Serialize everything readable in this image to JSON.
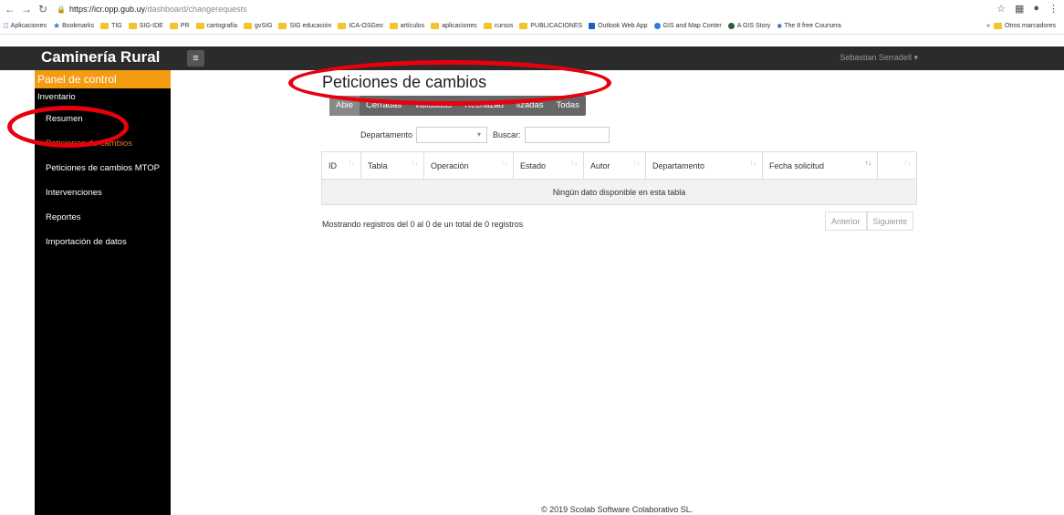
{
  "browser": {
    "url_host": "https://icr.opp.gub.uy",
    "url_path": "/dashboard/changerequests",
    "bookmarks": [
      {
        "label": "Aplicaciones",
        "icon": "apps-grid-icon"
      },
      {
        "label": "Bookmarks",
        "icon": "star-icon"
      },
      {
        "label": "TIG",
        "icon": "folder-icon"
      },
      {
        "label": "SIG-IDE",
        "icon": "folder-icon"
      },
      {
        "label": "PR",
        "icon": "folder-icon"
      },
      {
        "label": "cartografía",
        "icon": "folder-icon"
      },
      {
        "label": "gvSIG",
        "icon": "folder-icon"
      },
      {
        "label": "SIG educación",
        "icon": "folder-icon"
      },
      {
        "label": "ICA-OSGeo",
        "icon": "folder-icon"
      },
      {
        "label": "artículos",
        "icon": "folder-icon"
      },
      {
        "label": "aplicaciones",
        "icon": "folder-icon"
      },
      {
        "label": "cursos",
        "icon": "folder-icon"
      },
      {
        "label": "PUBLICACIONES",
        "icon": "folder-icon"
      },
      {
        "label": "Outlook Web App",
        "icon": "outlook-icon"
      },
      {
        "label": "GIS and Map Conter",
        "icon": "globe-icon"
      },
      {
        "label": "A GIS Story",
        "icon": "globe-icon"
      },
      {
        "label": "The 8 free Coursera",
        "icon": "coursera-icon"
      }
    ],
    "more": "»",
    "other_bookmarks": "Otros marcadores"
  },
  "app": {
    "brand": "Caminería Rural",
    "menu_toggle": "≡",
    "user": "Sebastian Serradell",
    "footer": "© 2019 Scolab Software Colaborativo SL."
  },
  "sidebar": {
    "header": "Panel de control",
    "items": [
      {
        "label": "Inventario"
      },
      {
        "label": "Resumen"
      },
      {
        "label": "Peticiones de cambios"
      },
      {
        "label": "Peticiones de cambios MTOP"
      },
      {
        "label": "Intervenciones"
      },
      {
        "label": "Reportes"
      },
      {
        "label": "Importación de datos"
      }
    ]
  },
  "main": {
    "title": "Peticiones de cambios",
    "tabs": [
      "Abie",
      "Cerradas",
      "Validadas",
      "Rechazad",
      "lizadas",
      "Todas"
    ],
    "filter_label": "Departamento",
    "search_label": "Buscar:",
    "columns": [
      "ID",
      "Tabla",
      "Operación",
      "Estado",
      "Autor",
      "Departamento",
      "Fecha solicitud",
      ""
    ],
    "empty_text": "Ningún dato disponible en esta tabla",
    "info": "Mostrando registros del 0 al 0 de un total de 0 registros",
    "prev": "Anterior",
    "next": "Siguiente"
  },
  "colors": {
    "accent": "#f39c12",
    "annotation": "#e8000d",
    "topbar": "#2b2b2b"
  }
}
